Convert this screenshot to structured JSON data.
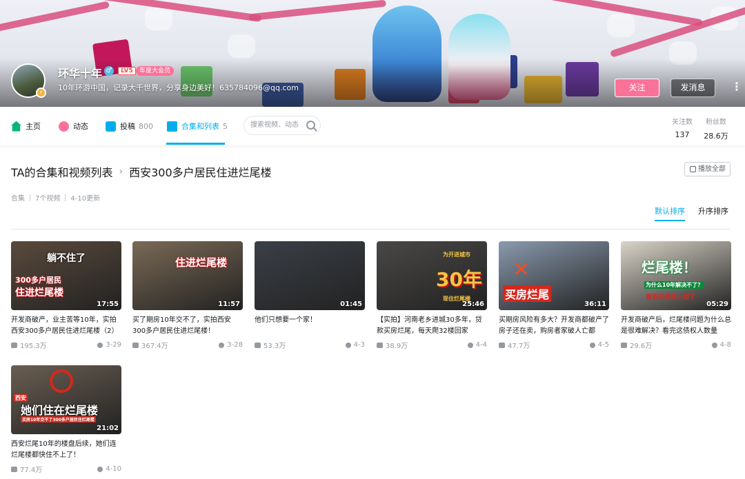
{
  "profile": {
    "name": "环华十年",
    "level": "LV5",
    "vip_badge": "年度大会员",
    "sign": "10年环游中国，记录大千世界，分享身边美好！635784096@qq.com",
    "follow_label": "关注",
    "message_label": "发消息",
    "more_label": "⋮"
  },
  "nav": {
    "items": [
      {
        "label": "主页",
        "icon": "home-icon",
        "count": ""
      },
      {
        "label": "动态",
        "icon": "dynamic-icon",
        "count": ""
      },
      {
        "label": "投稿",
        "icon": "upload-icon",
        "count": "800"
      },
      {
        "label": "合集和列表",
        "icon": "collection-icon",
        "count": "5"
      }
    ],
    "search_placeholder": "搜索视频、动态",
    "stats": [
      {
        "label": "关注数",
        "value": "137"
      },
      {
        "label": "粉丝数",
        "value": "28.6万"
      }
    ]
  },
  "collection": {
    "breadcrumb_parent": "TA的合集和视频列表",
    "breadcrumb_current": "西安300多户居民住进烂尾楼",
    "play_all": "播放全部",
    "type": "合集",
    "count": "7个视频",
    "updated": "4-10更新",
    "sort_default": "默认排序",
    "sort_asc": "升序排序"
  },
  "videos": [
    {
      "title": "开发商破产，业主苦等10年，实拍西安300多户居民住进烂尾楼（2）",
      "views": "195.3万",
      "date": "3-29",
      "duration": "17:55",
      "caption": "躺不住了",
      "caption2": "300多户居民",
      "caption3": "住进烂尾楼",
      "thumb_bg": "#5a4a3c"
    },
    {
      "title": "买了期房10年交不了，实拍西安300多户居民住进烂尾楼！",
      "views": "367.4万",
      "date": "3-28",
      "duration": "11:57",
      "caption": "住进烂尾楼",
      "thumb_bg": "#7b6a56"
    },
    {
      "title": "他们只想要一个家！",
      "views": "53.3万",
      "date": "4-3",
      "duration": "01:45",
      "caption": "",
      "thumb_bg": "#3b4047"
    },
    {
      "title": "【实拍】河南老乡进城30多年，贷款买房烂尾，每天爬32楼回家",
      "views": "38.9万",
      "date": "4-4",
      "duration": "25:46",
      "caption": "30年",
      "caption2": "为开进城市",
      "caption3": "现住烂尾楼",
      "thumb_bg": "#4a4846"
    },
    {
      "title": "买期房风险有多大？开发商都破产了房子还在卖，购房者家破人亡都",
      "views": "47.7万",
      "date": "4-5",
      "duration": "36:11",
      "caption": "买房烂尾",
      "thumb_bg": "#8a9aae"
    },
    {
      "title": "开发商破产后，烂尾楼问题为什么总是很难解决？看完这债权人数量",
      "views": "29.6万",
      "date": "4-8",
      "duration": "05:29",
      "caption": "烂尾楼！",
      "caption2": "为什么10年解决不了？",
      "caption3": "看到这债权人惊了",
      "thumb_bg": "#d9d4c8"
    },
    {
      "title": "西安烂尾10年的楼盘后续，她们连烂尾楼都快住不上了！",
      "views": "77.4万",
      "date": "4-10",
      "duration": "21:02",
      "caption": "她们住在烂尾楼",
      "caption2": "西安",
      "caption3": "买房10年交不了300多户居民住烂尾楼",
      "thumb_bg": "#6a5e52"
    }
  ],
  "colors": {
    "accent": "#00aeec",
    "pink": "#fb7299",
    "muted": "#9499a0"
  }
}
